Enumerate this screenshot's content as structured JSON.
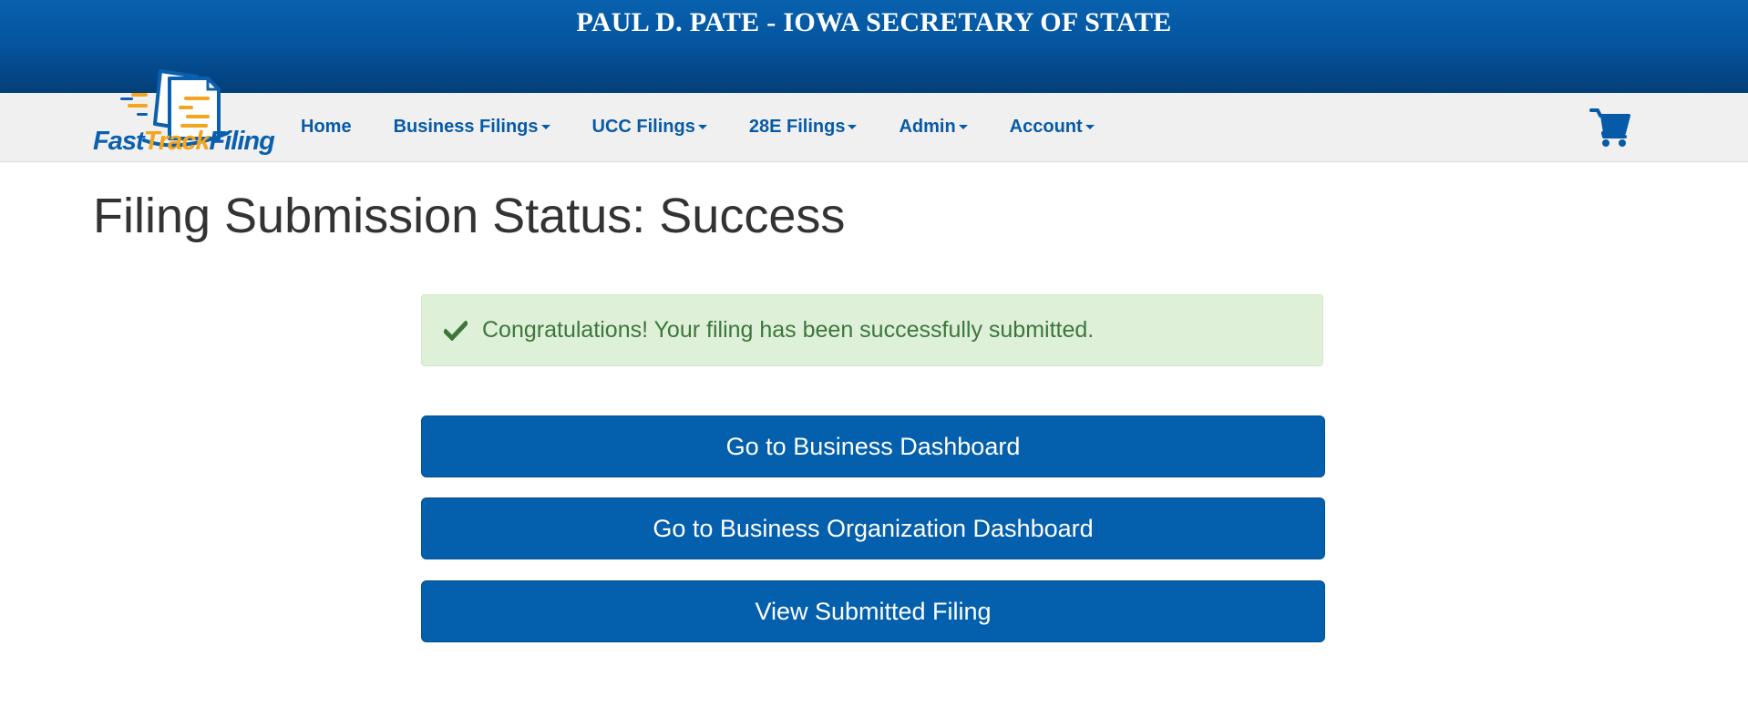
{
  "header": {
    "title": "PAUL D. PATE - IOWA SECRETARY OF STATE"
  },
  "logo": {
    "icon": "document-stack-icon",
    "text_fast": "Fast",
    "text_track": "Track",
    "text_filing": "Filing",
    "colors": {
      "blue": "#0a60ae",
      "orange": "#f3a51d"
    }
  },
  "nav": {
    "items": [
      {
        "label": "Home",
        "dropdown": false
      },
      {
        "label": "Business Filings",
        "dropdown": true
      },
      {
        "label": "UCC Filings",
        "dropdown": true
      },
      {
        "label": "28E Filings",
        "dropdown": true
      },
      {
        "label": "Admin",
        "dropdown": true
      },
      {
        "label": "Account",
        "dropdown": true
      }
    ],
    "cart_icon": "shopping-cart-icon"
  },
  "main": {
    "page_title": "Filing Submission Status: Success",
    "alert": {
      "icon": "checkmark-icon",
      "message": "Congratulations! Your filing has been successfully submitted."
    },
    "buttons": {
      "business_dashboard": "Go to Business Dashboard",
      "org_dashboard": "Go to Business Organization Dashboard",
      "view_filing": "View Submitted Filing"
    }
  },
  "colors": {
    "banner": "#0455a0",
    "nav_link": "#075aa7",
    "button": "#045fac",
    "alert_bg": "#dff0d8",
    "alert_text": "#3c763d"
  }
}
